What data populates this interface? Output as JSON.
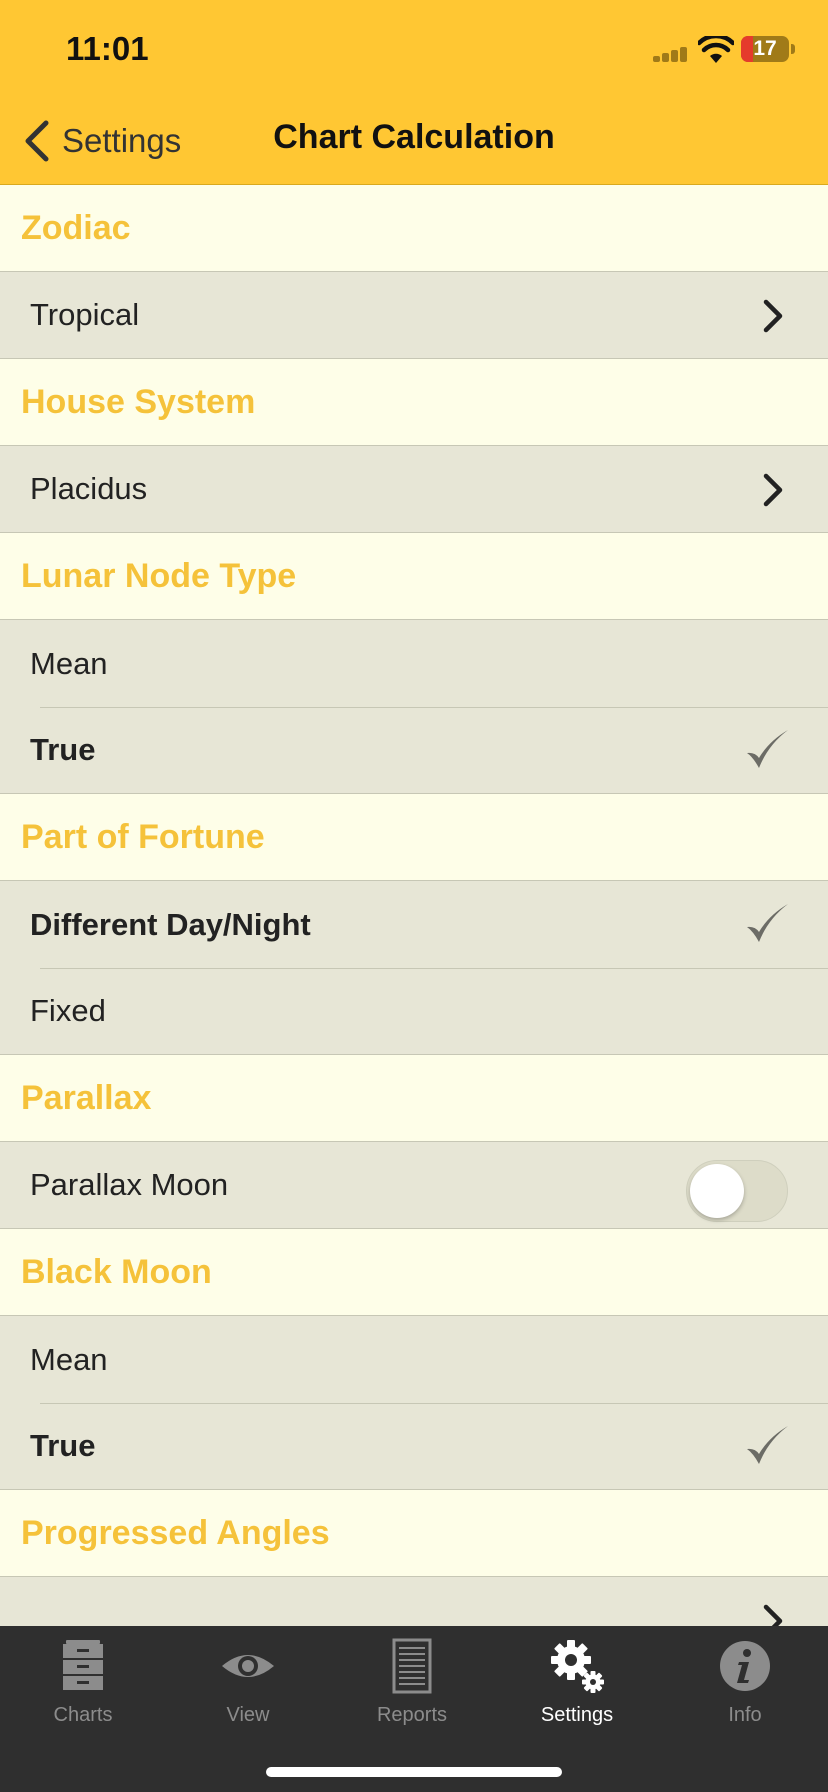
{
  "status": {
    "time": "11:01",
    "battery": "17"
  },
  "nav": {
    "back_label": "Settings",
    "title": "Chart Calculation"
  },
  "sections": [
    {
      "title": "Zodiac",
      "rows": [
        {
          "label": "Tropical",
          "accessory": "chevron"
        }
      ]
    },
    {
      "title": "House System",
      "rows": [
        {
          "label": "Placidus",
          "accessory": "chevron"
        }
      ]
    },
    {
      "title": "Lunar Node Type",
      "rows": [
        {
          "label": "Mean"
        },
        {
          "label": "True",
          "selected": true
        }
      ]
    },
    {
      "title": "Part of Fortune",
      "rows": [
        {
          "label": "Different Day/Night",
          "selected": true
        },
        {
          "label": "Fixed"
        }
      ]
    },
    {
      "title": "Parallax",
      "rows": [
        {
          "label": "Parallax Moon",
          "accessory": "toggle",
          "on": false
        }
      ]
    },
    {
      "title": "Black Moon",
      "rows": [
        {
          "label": "Mean"
        },
        {
          "label": "True",
          "selected": true
        }
      ]
    },
    {
      "title": "Progressed Angles",
      "rows": []
    }
  ],
  "tabs": [
    {
      "label": "Charts",
      "icon": "cabinet-icon"
    },
    {
      "label": "View",
      "icon": "eye-icon"
    },
    {
      "label": "Reports",
      "icon": "document-icon"
    },
    {
      "label": "Settings",
      "icon": "gears-icon",
      "active": true
    },
    {
      "label": "Info",
      "icon": "info-icon"
    }
  ],
  "colors": {
    "header": "#ffc733",
    "section_title": "#f5c23a",
    "row_bg": "#e7e6d6",
    "tabbar": "#2f2f2f"
  }
}
